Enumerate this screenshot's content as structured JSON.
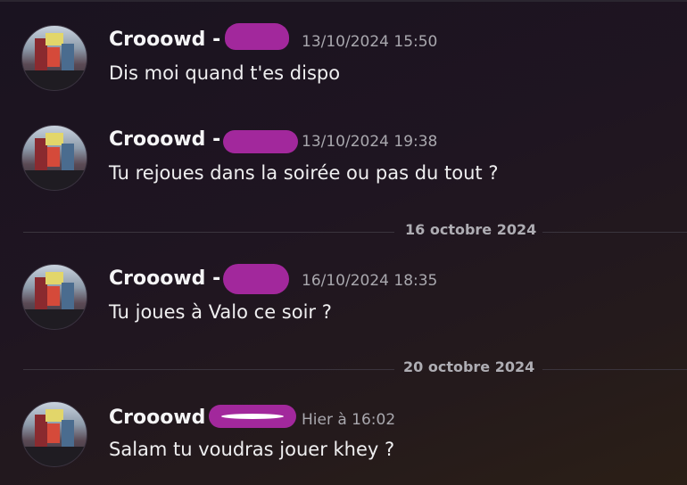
{
  "messages": [
    {
      "username": "Crooowd -",
      "timestamp": "13/10/2024 15:50",
      "text": "Dis moi quand t'es dispo"
    },
    {
      "username": "Crooowd -",
      "timestamp": "13/10/2024 19:38",
      "text": "Tu rejoues dans la soirée ou pas du tout ?"
    },
    {
      "username": "Crooowd -",
      "timestamp": "16/10/2024 18:35",
      "text": "Tu joues à Valo ce soir ?"
    },
    {
      "username": "Crooowd",
      "timestamp": "Hier à 16:02",
      "text": "Salam tu voudras jouer khey ?"
    }
  ],
  "dividers": [
    {
      "label": "16 octobre 2024"
    },
    {
      "label": "20 octobre 2024"
    }
  ],
  "colors": {
    "redaction": "#a2289c",
    "timestamp": "#a9a8ae",
    "background": "#1c1520"
  }
}
